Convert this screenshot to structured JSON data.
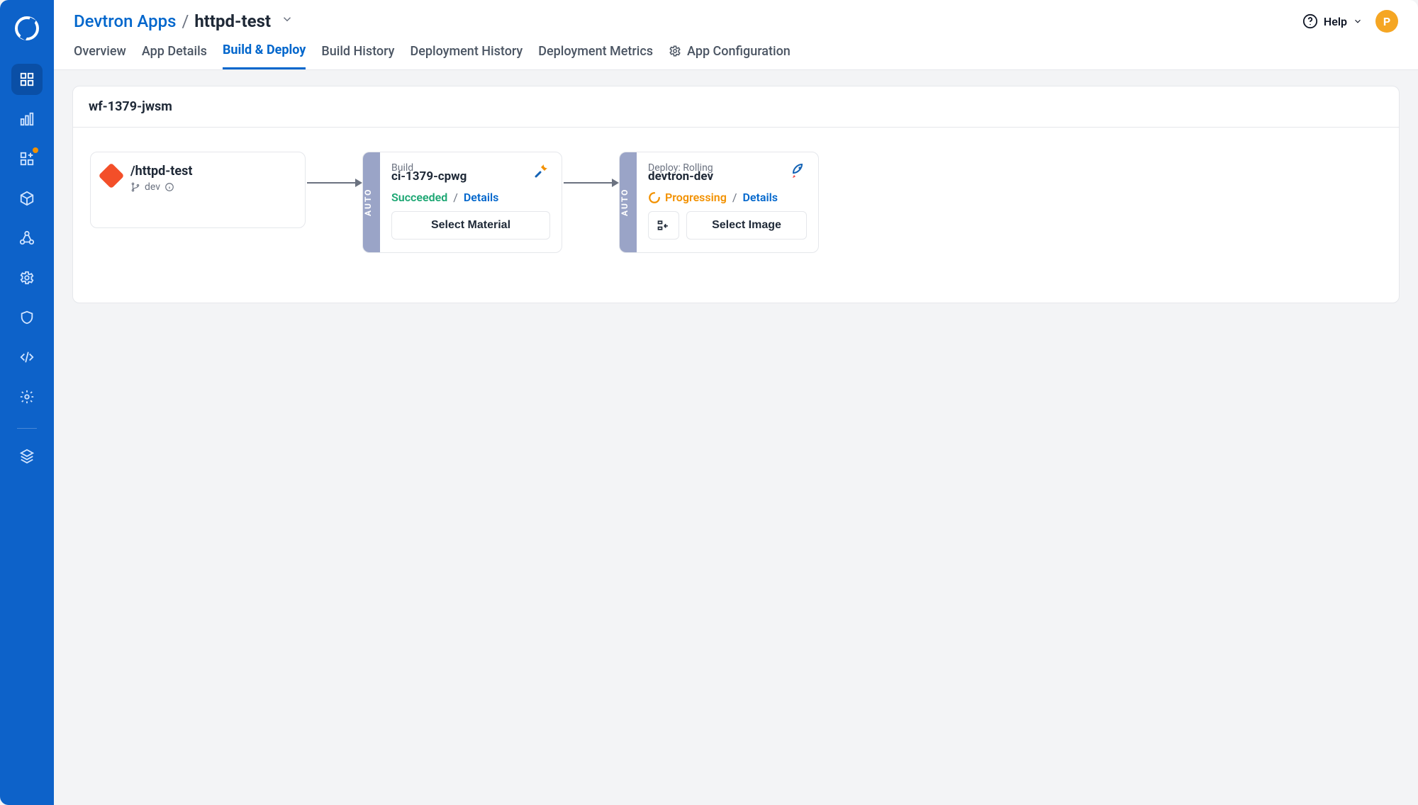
{
  "breadcrumb": {
    "group": "Devtron Apps",
    "separator": "/",
    "current": "httpd-test"
  },
  "help_label": "Help",
  "avatar_initial": "P",
  "tabs": [
    "Overview",
    "App Details",
    "Build & Deploy",
    "Build History",
    "Deployment History",
    "Deployment Metrics",
    "App Configuration"
  ],
  "active_tab_index": 2,
  "workflow": {
    "name": "wf-1379-jwsm",
    "auto_label": "AUTO",
    "source": {
      "title": "/httpd-test",
      "branch_label": "dev"
    },
    "build": {
      "type_label": "Build",
      "name": "ci-1379-cpwg",
      "status": "Succeeded",
      "details_label": "Details",
      "action": "Select Material"
    },
    "deploy": {
      "type_label": "Deploy: Rolling",
      "name": "devtron-dev",
      "status": "Progressing",
      "details_label": "Details",
      "action": "Select Image"
    }
  }
}
